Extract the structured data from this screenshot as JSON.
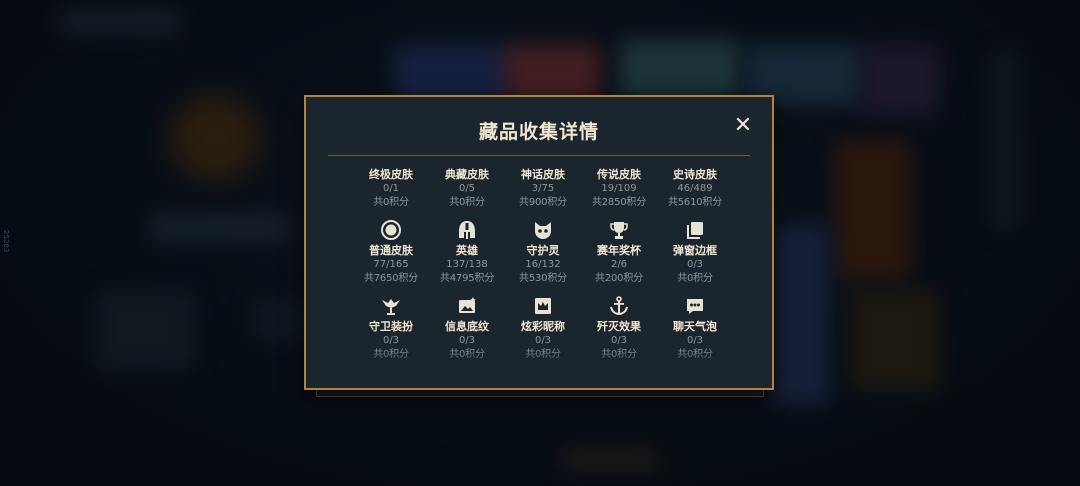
{
  "side_label": "25283",
  "modal": {
    "title": "藏品收集详情",
    "close_label": "✕"
  },
  "items": [
    {
      "name": "终极皮肤",
      "count": "0/1",
      "points": "共0积分",
      "icon": "none"
    },
    {
      "name": "典藏皮肤",
      "count": "0/5",
      "points": "共0积分",
      "icon": "none"
    },
    {
      "name": "神话皮肤",
      "count": "3/75",
      "points": "共900积分",
      "icon": "none"
    },
    {
      "name": "传说皮肤",
      "count": "19/109",
      "points": "共2850积分",
      "icon": "none"
    },
    {
      "name": "史诗皮肤",
      "count": "46/489",
      "points": "共5610积分",
      "icon": "none"
    },
    {
      "name": "普通皮肤",
      "count": "77/165",
      "points": "共7650积分",
      "icon": "ring-icon"
    },
    {
      "name": "英雄",
      "count": "137/138",
      "points": "共4795积分",
      "icon": "helmet-icon"
    },
    {
      "name": "守护灵",
      "count": "16/132",
      "points": "共530积分",
      "icon": "pet-icon"
    },
    {
      "name": "赛年奖杯",
      "count": "2/6",
      "points": "共200积分",
      "icon": "trophy-icon"
    },
    {
      "name": "弹窗边框",
      "count": "0/3",
      "points": "共0积分",
      "icon": "frame-icon"
    },
    {
      "name": "守卫装扮",
      "count": "0/3",
      "points": "共0积分",
      "icon": "ward-icon"
    },
    {
      "name": "信息底纹",
      "count": "0/3",
      "points": "共0积分",
      "icon": "banner-icon"
    },
    {
      "name": "炫彩昵称",
      "count": "0/3",
      "points": "共0积分",
      "icon": "crown-icon"
    },
    {
      "name": "歼灭效果",
      "count": "0/3",
      "points": "共0积分",
      "icon": "anchor-icon"
    },
    {
      "name": "聊天气泡",
      "count": "0/3",
      "points": "共0积分",
      "icon": "chat-bubble-icon"
    }
  ],
  "colors": {
    "accent_gold": "#a8864a",
    "panel_bg": "#1b252d",
    "title_text": "#f0e6d2",
    "muted_text": "#8e979c"
  }
}
